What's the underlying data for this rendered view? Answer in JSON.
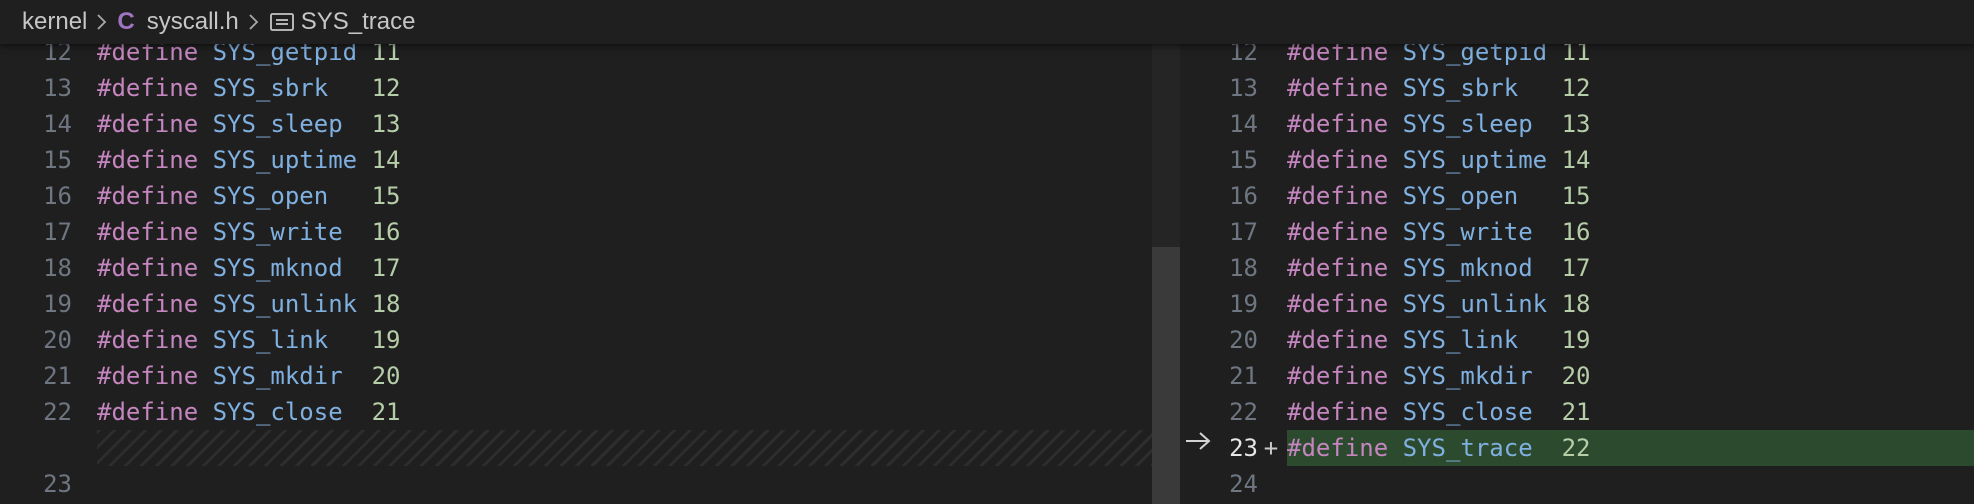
{
  "breadcrumb": {
    "folder": "kernel",
    "file_icon": "C",
    "file": "syscall.h",
    "symbol": "SYS_trace"
  },
  "left_pane": {
    "lines": [
      {
        "n": "12",
        "kw": "#define",
        "name": "SYS_getpid",
        "pad": " ",
        "val": "11"
      },
      {
        "n": "13",
        "kw": "#define",
        "name": "SYS_sbrk",
        "pad": "   ",
        "val": "12"
      },
      {
        "n": "14",
        "kw": "#define",
        "name": "SYS_sleep",
        "pad": "  ",
        "val": "13"
      },
      {
        "n": "15",
        "kw": "#define",
        "name": "SYS_uptime",
        "pad": " ",
        "val": "14"
      },
      {
        "n": "16",
        "kw": "#define",
        "name": "SYS_open",
        "pad": "   ",
        "val": "15"
      },
      {
        "n": "17",
        "kw": "#define",
        "name": "SYS_write",
        "pad": "  ",
        "val": "16"
      },
      {
        "n": "18",
        "kw": "#define",
        "name": "SYS_mknod",
        "pad": "  ",
        "val": "17"
      },
      {
        "n": "19",
        "kw": "#define",
        "name": "SYS_unlink",
        "pad": " ",
        "val": "18"
      },
      {
        "n": "20",
        "kw": "#define",
        "name": "SYS_link",
        "pad": "   ",
        "val": "19"
      },
      {
        "n": "21",
        "kw": "#define",
        "name": "SYS_mkdir",
        "pad": "  ",
        "val": "20"
      },
      {
        "n": "22",
        "kw": "#define",
        "name": "SYS_close",
        "pad": "  ",
        "val": "21"
      }
    ],
    "trailing_line": "23"
  },
  "right_pane": {
    "lines": [
      {
        "n": "12",
        "kw": "#define",
        "name": "SYS_getpid",
        "pad": " ",
        "val": "11"
      },
      {
        "n": "13",
        "kw": "#define",
        "name": "SYS_sbrk",
        "pad": "   ",
        "val": "12"
      },
      {
        "n": "14",
        "kw": "#define",
        "name": "SYS_sleep",
        "pad": "  ",
        "val": "13"
      },
      {
        "n": "15",
        "kw": "#define",
        "name": "SYS_uptime",
        "pad": " ",
        "val": "14"
      },
      {
        "n": "16",
        "kw": "#define",
        "name": "SYS_open",
        "pad": "   ",
        "val": "15"
      },
      {
        "n": "17",
        "kw": "#define",
        "name": "SYS_write",
        "pad": "  ",
        "val": "16"
      },
      {
        "n": "18",
        "kw": "#define",
        "name": "SYS_mknod",
        "pad": "  ",
        "val": "17"
      },
      {
        "n": "19",
        "kw": "#define",
        "name": "SYS_unlink",
        "pad": " ",
        "val": "18"
      },
      {
        "n": "20",
        "kw": "#define",
        "name": "SYS_link",
        "pad": "   ",
        "val": "19"
      },
      {
        "n": "21",
        "kw": "#define",
        "name": "SYS_mkdir",
        "pad": "  ",
        "val": "20"
      },
      {
        "n": "22",
        "kw": "#define",
        "name": "SYS_close",
        "pad": "  ",
        "val": "21"
      }
    ],
    "added_line": {
      "n": "23",
      "marker": "+",
      "kw": "#define",
      "name": "SYS_trace",
      "pad": "  ",
      "val": "22"
    },
    "trailing_line": "24"
  },
  "colors": {
    "background": "#1f1f1f",
    "keyword": "#c586c0",
    "identifier": "#7fb0e0",
    "number": "#b5cea8",
    "added_line_bg": "#2c4a2e",
    "line_number": "#6e7681"
  },
  "icons": {
    "chevron": "chevron-right-icon",
    "file_type": "c-file-icon",
    "symbol": "symbol-constant-icon",
    "diff_arrow": "arrow-right-icon"
  }
}
